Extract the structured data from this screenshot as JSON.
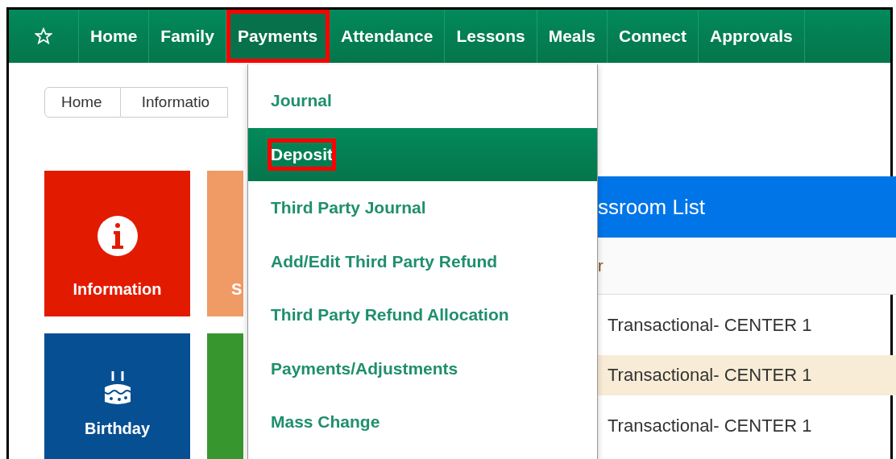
{
  "nav": {
    "items": [
      {
        "label": "Home",
        "selected": false,
        "highlighted": false
      },
      {
        "label": "Family",
        "selected": false,
        "highlighted": false
      },
      {
        "label": "Payments",
        "selected": true,
        "highlighted": true
      },
      {
        "label": "Attendance",
        "selected": false,
        "highlighted": false
      },
      {
        "label": "Lessons",
        "selected": false,
        "highlighted": false
      },
      {
        "label": "Meals",
        "selected": false,
        "highlighted": false
      },
      {
        "label": "Connect",
        "selected": false,
        "highlighted": false
      },
      {
        "label": "Approvals",
        "selected": false,
        "highlighted": false
      }
    ]
  },
  "breadcrumb": [
    "Home",
    "Informatio"
  ],
  "tiles": [
    {
      "label": "Information",
      "color": "#e21b00",
      "kind": "info"
    },
    {
      "label": "S",
      "color": "#f09a66",
      "kind": "plain"
    },
    {
      "label": "Birthday",
      "color": "#074f93",
      "kind": "cake"
    },
    {
      "color": "#38962f",
      "kind": "plain"
    }
  ],
  "menu": {
    "items": [
      {
        "label": "Journal",
        "selected": false,
        "highlighted": false
      },
      {
        "label": "Deposit",
        "selected": true,
        "highlighted": true
      },
      {
        "label": "Third Party Journal",
        "selected": false,
        "highlighted": false
      },
      {
        "label": "Add/Edit Third Party Refund",
        "selected": false,
        "highlighted": false
      },
      {
        "label": "Third Party Refund Allocation",
        "selected": false,
        "highlighted": false
      },
      {
        "label": "Payments/Adjustments",
        "selected": false,
        "highlighted": false
      },
      {
        "label": "Mass Change",
        "selected": false,
        "highlighted": false
      }
    ]
  },
  "panel": {
    "title": "ssroom List",
    "column_1": "r",
    "rows": [
      {
        "cell": "Transactional- CENTER 1",
        "selected": false
      },
      {
        "cell": "Transactional- CENTER 1",
        "selected": true
      },
      {
        "cell": "Transactional- CENTER 1",
        "selected": false
      }
    ]
  }
}
